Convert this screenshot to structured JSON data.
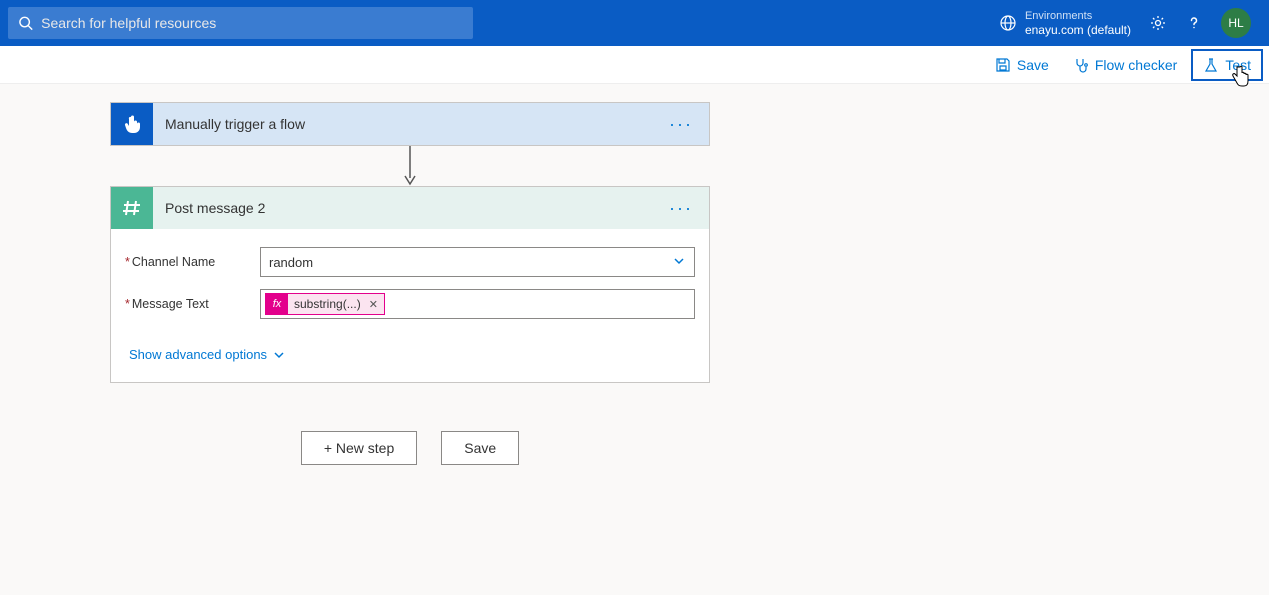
{
  "header": {
    "search_placeholder": "Search for helpful resources",
    "env_label": "Environments",
    "env_name": "enayu.com (default)",
    "avatar_initials": "HL"
  },
  "toolbar": {
    "save": "Save",
    "flow_checker": "Flow checker",
    "test": "Test"
  },
  "trigger": {
    "title": "Manually trigger a flow"
  },
  "action": {
    "title": "Post message 2",
    "fields": {
      "channel_label": "Channel Name",
      "channel_value": "random",
      "message_label": "Message Text",
      "message_token": "substring(...)"
    },
    "advanced_options": "Show advanced options"
  },
  "footer": {
    "new_step": "+ New step",
    "save": "Save"
  }
}
